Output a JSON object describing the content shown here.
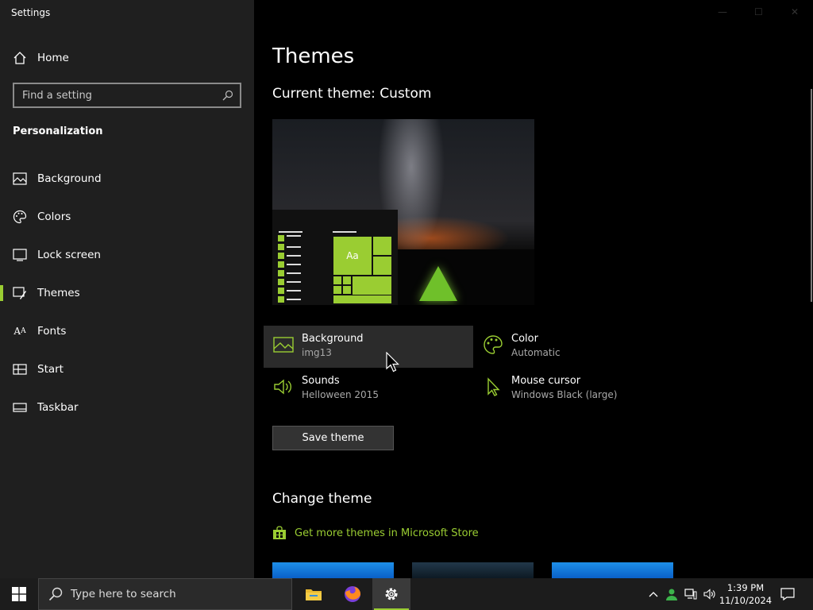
{
  "window": {
    "title": "Settings"
  },
  "sidebar": {
    "home_label": "Home",
    "search_placeholder": "Find a setting",
    "section": "Personalization",
    "items": [
      {
        "label": "Background",
        "icon": "image-icon"
      },
      {
        "label": "Colors",
        "icon": "palette-icon"
      },
      {
        "label": "Lock screen",
        "icon": "lock-screen-icon"
      },
      {
        "label": "Themes",
        "icon": "themes-icon",
        "active": true
      },
      {
        "label": "Fonts",
        "icon": "fonts-icon"
      },
      {
        "label": "Start",
        "icon": "start-icon"
      },
      {
        "label": "Taskbar",
        "icon": "taskbar-icon"
      }
    ]
  },
  "main": {
    "title": "Themes",
    "current_theme": "Current theme: Custom",
    "options": {
      "background": {
        "label": "Background",
        "value": "img13"
      },
      "color": {
        "label": "Color",
        "value": "Automatic"
      },
      "sounds": {
        "label": "Sounds",
        "value": "Helloween 2015"
      },
      "cursor": {
        "label": "Mouse cursor",
        "value": "Windows Black (large)"
      }
    },
    "save_label": "Save theme",
    "change_title": "Change theme",
    "store_link": "Get more themes in Microsoft Store",
    "preview_tile_text": "Aa"
  },
  "taskbar": {
    "search_placeholder": "Type here to search",
    "time": "1:39 PM",
    "date": "11/10/2024"
  },
  "colors": {
    "accent": "#9acd32",
    "sidebar_bg": "#1f1f1f",
    "main_bg": "#000000"
  }
}
